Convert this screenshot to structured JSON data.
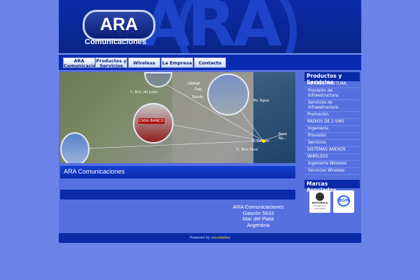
{
  "header": {
    "logo_main": "ARA",
    "logo_sub": "Comunicaciones",
    "bg_text": "ARA"
  },
  "nav": {
    "tabs": [
      {
        "label": "ARA Comunicaciones"
      },
      {
        "label": "Productos y Servicios"
      },
      {
        "label": "Wireless"
      },
      {
        "label": "La Empresa"
      },
      {
        "label": "Contacto"
      }
    ]
  },
  "map": {
    "labels": [
      "C. Bco. de Justo",
      "UNMdP",
      "Dep.",
      "Toledo",
      "Bv. Agua",
      "N. Gobolo",
      "C. Bco. Paus",
      "Base Na..."
    ],
    "sign_text": "CASA BIANCO"
  },
  "main": {
    "title": "ARA Comunicaciones",
    "address": [
      "ARA Comunicaciones",
      "Gascón 5633",
      "Mar del Plata",
      "Argentina"
    ]
  },
  "sidebar": {
    "heading": "Productos y Servicios",
    "items": [
      {
        "label": "INFRAESTRUCTURA",
        "sub": false
      },
      {
        "label": "Provisión de Infraestructura",
        "sub": true
      },
      {
        "label": "Servicios de Infraestructura",
        "sub": true
      },
      {
        "label": "Promoción",
        "sub": false
      },
      {
        "label": "RADIOS DE 2 VIAS",
        "sub": false
      },
      {
        "label": "Ingeniería",
        "sub": true
      },
      {
        "label": "Provisión",
        "sub": true
      },
      {
        "label": "Servicios",
        "sub": true
      },
      {
        "label": "SISTEMAS ANEXOS",
        "sub": false
      },
      {
        "label": "WIRELESS",
        "sub": false
      },
      {
        "label": "Ingeniería Wireless",
        "sub": true
      },
      {
        "label": "Servicios Wireless",
        "sub": true
      }
    ],
    "brands_heading": "Marcas Asociadas",
    "brands": [
      {
        "name": "MOTOROLA",
        "caption": "distribuidor autorizado"
      },
      {
        "name": "BGH"
      }
    ]
  },
  "footer": {
    "prefix": "Powered by",
    "link": "oncedados"
  },
  "colors": {
    "page_bg": "#6b83e8",
    "header_bg": "#0b2aa8",
    "bar_blue": "#0a2aa8"
  }
}
